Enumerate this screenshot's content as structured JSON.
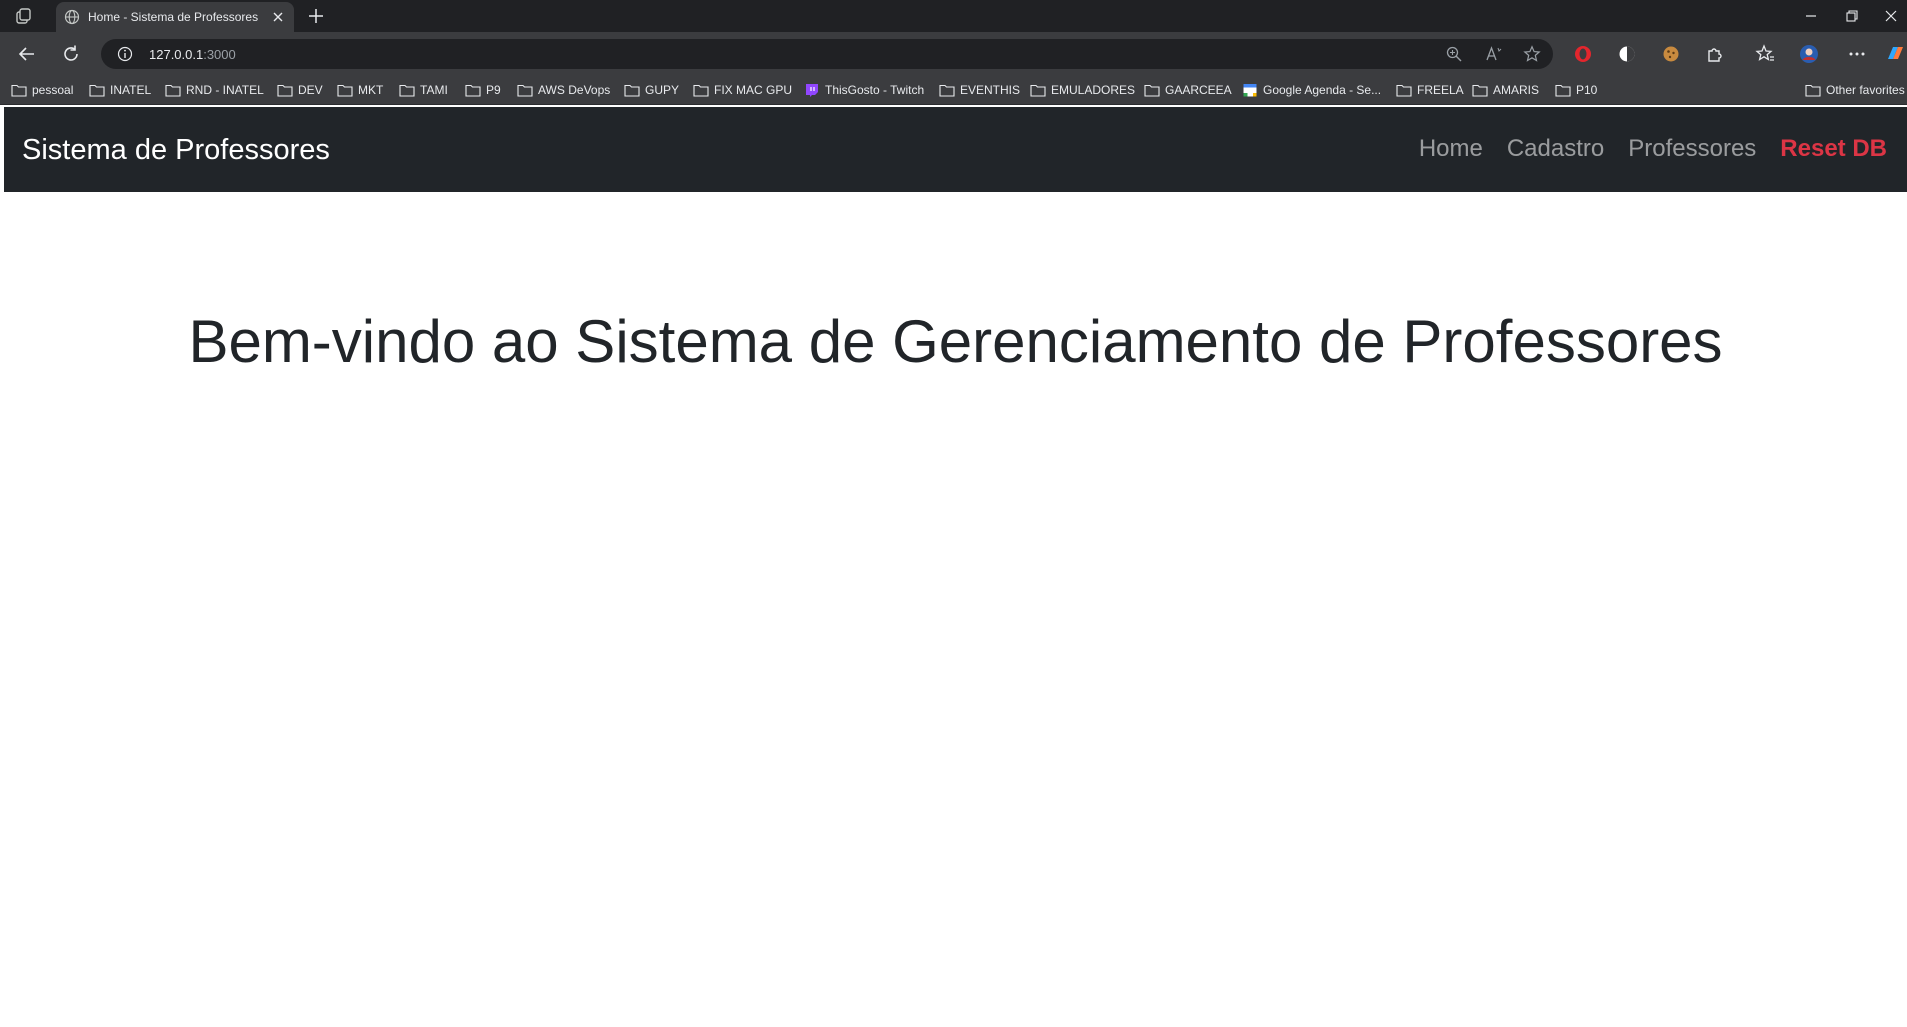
{
  "browser": {
    "tab_title": "Home - Sistema de Professores",
    "url_host": "127.0.0.1",
    "url_port": ":3000",
    "bookmarks": [
      {
        "label": "pessoal",
        "icon": "folder-icon"
      },
      {
        "label": "INATEL",
        "icon": "folder-icon"
      },
      {
        "label": "RND - INATEL",
        "icon": "folder-icon"
      },
      {
        "label": "DEV",
        "icon": "folder-icon"
      },
      {
        "label": "MKT",
        "icon": "folder-icon"
      },
      {
        "label": "TAMI",
        "icon": "folder-icon"
      },
      {
        "label": "P9",
        "icon": "folder-icon"
      },
      {
        "label": "AWS DeVops",
        "icon": "folder-icon"
      },
      {
        "label": "GUPY",
        "icon": "folder-icon"
      },
      {
        "label": "FIX MAC GPU",
        "icon": "folder-icon"
      },
      {
        "label": "ThisGosto - Twitch",
        "icon": "twitch-icon"
      },
      {
        "label": "EVENTHIS",
        "icon": "folder-icon"
      },
      {
        "label": "EMULADORES",
        "icon": "folder-icon"
      },
      {
        "label": "GAARCEEA",
        "icon": "folder-icon"
      },
      {
        "label": "Google Agenda - Se...",
        "icon": "calendar-icon"
      },
      {
        "label": "FREELA",
        "icon": "folder-icon"
      },
      {
        "label": "AMARIS",
        "icon": "folder-icon"
      },
      {
        "label": "P10",
        "icon": "folder-icon"
      }
    ],
    "other_favorites": "Other favorites"
  },
  "navbar": {
    "brand": "Sistema de Professores",
    "links": {
      "home": "Home",
      "cadastro": "Cadastro",
      "professores": "Professores",
      "reset": "Reset DB"
    }
  },
  "main": {
    "heading": "Bem-vindo ao Sistema de Gerenciamento de Professores"
  },
  "colors": {
    "navbar_bg": "#212529",
    "danger": "#dc3545",
    "text_dark": "#212529"
  }
}
